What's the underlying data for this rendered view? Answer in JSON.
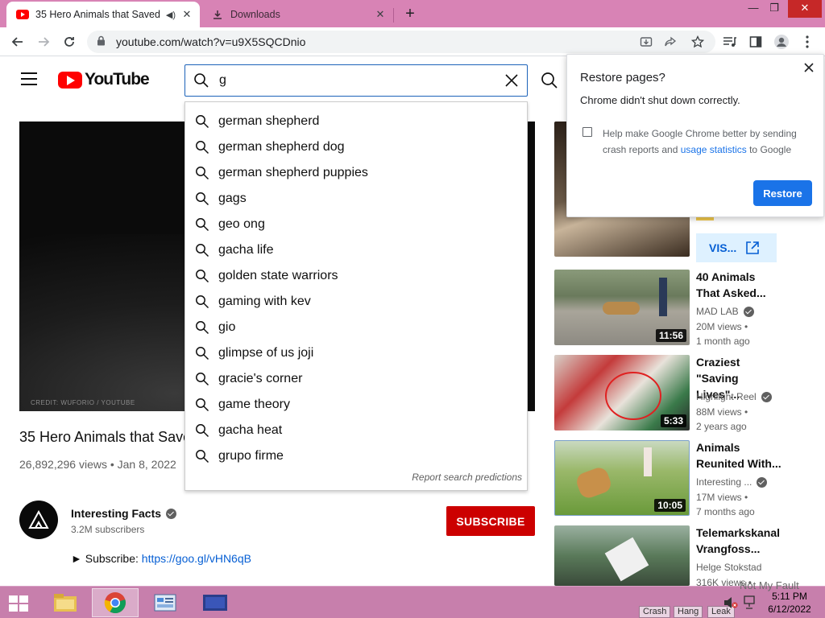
{
  "browser": {
    "tabs": [
      {
        "title": "35 Hero Animals that Saved",
        "active": true
      },
      {
        "title": "Downloads",
        "active": false
      }
    ],
    "url": "youtube.com/watch?v=u9X5SQCDnio"
  },
  "youtube": {
    "logo_text": "YouTube",
    "search_value": "g",
    "suggestions": [
      "german shepherd",
      "german shepherd dog",
      "german shepherd puppies",
      "gags",
      "geo ong",
      "gacha life",
      "golden state warriors",
      "gaming with kev",
      "gio",
      "glimpse of us joji",
      "gracie's corner",
      "game theory",
      "gacha heat",
      "grupo firme"
    ],
    "report_link": "Report search predictions",
    "video": {
      "credit": "CREDIT: WUFORIO / YOUTUBE",
      "title": "35 Hero Animals that Saved",
      "views_date": "26,892,296 views • Jan 8, 2022"
    },
    "channel": {
      "name": "Interesting Facts",
      "subscribers": "3.2M subscribers",
      "subscribe_label": "SUBSCRIBE"
    },
    "description": {
      "prefix": "► Subscribe: ",
      "link": "https://goo.gl/vHN6qB"
    },
    "ad": {
      "visit_label": "VIS..."
    },
    "recommended": [
      {
        "title_l1": "40 Animals",
        "title_l2": "That Asked...",
        "channel": "MAD LAB",
        "views": "20M views •",
        "age": "1 month ago",
        "duration": "11:56"
      },
      {
        "title_l1": "Craziest",
        "title_l2": "\"Saving Lives\"...",
        "channel": "Highlight Reel",
        "views": "88M views •",
        "age": "2 years ago",
        "duration": "5:33"
      },
      {
        "title_l1": "Animals",
        "title_l2": "Reunited With...",
        "channel": "Interesting ...",
        "views": "17M views •",
        "age": "7 months ago",
        "duration": "10:05"
      },
      {
        "title_l1": "Telemarkskanal",
        "title_l2": "Vrangfoss...",
        "channel": "Helge Stokstad",
        "views": "316K views •",
        "age": "",
        "duration": ""
      }
    ]
  },
  "popup": {
    "title": "Restore pages?",
    "message": "Chrome didn't shut down correctly.",
    "checkbox_text_1": "Help make Google Chrome better by sending crash reports and ",
    "checkbox_link": "usage statistics",
    "checkbox_text_2": " to Google",
    "restore_label": "Restore"
  },
  "taskbar": {
    "time": "5:11 PM",
    "date": "6/12/2022",
    "watermark": "Not My Fault",
    "tray_buttons": [
      "Crash",
      "Hang",
      "Leak"
    ]
  }
}
